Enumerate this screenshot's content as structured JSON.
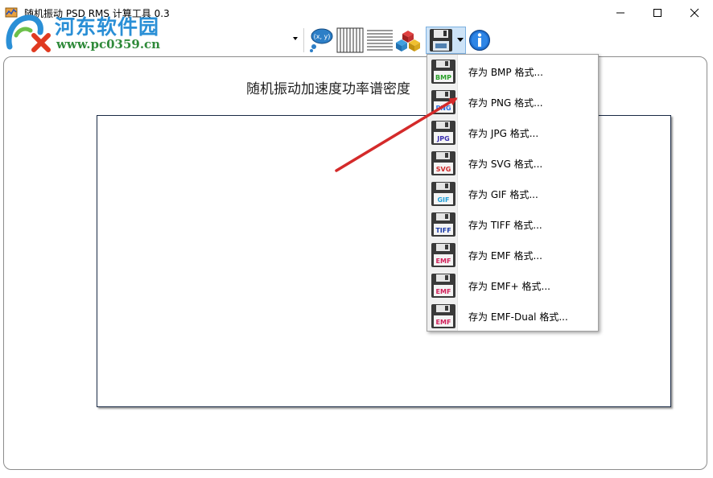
{
  "window": {
    "title": "随机振动 PSD RMS 计算工具 0.3"
  },
  "watermark": {
    "title": "河东软件园",
    "url": "www.pc0359.cn"
  },
  "toolbar": {
    "combo_value": "",
    "buttons": [
      "xy-coordinates-icon",
      "vertical-grid-icon",
      "horizontal-grid-icon",
      "cubes-icon",
      "save-disk-icon",
      "info-icon"
    ]
  },
  "chart": {
    "title": "随机振动加速度功率谱密度"
  },
  "save_menu": {
    "items": [
      {
        "label": "存为 BMP 格式...",
        "badge": "BMP",
        "color": "#2aa02a"
      },
      {
        "label": "存为 PNG 格式...",
        "badge": "PNG",
        "color": "#2a6fe0"
      },
      {
        "label": "存为 JPG 格式...",
        "badge": "JPG",
        "color": "#3a2fb0"
      },
      {
        "label": "存为 SVG 格式...",
        "badge": "SVG",
        "color": "#d02828"
      },
      {
        "label": "存为 GIF 格式...",
        "badge": "GIF",
        "color": "#1f9fd8"
      },
      {
        "label": "存为 TIFF 格式...",
        "badge": "TIFF",
        "color": "#1a3aa8"
      },
      {
        "label": "存为 EMF 格式...",
        "badge": "EMF",
        "color": "#d0205a"
      },
      {
        "label": "存为 EMF+ 格式...",
        "badge": "EMF",
        "color": "#d0205a"
      },
      {
        "label": "存为 EMF-Dual 格式...",
        "badge": "EMF",
        "color": "#d0205a"
      }
    ]
  },
  "colors": {
    "annotation_arrow": "#d42a2a",
    "save_button_highlight": "#cde3f7",
    "watermark_blue": "#2a8fd6",
    "watermark_green": "#2f8a3a"
  }
}
